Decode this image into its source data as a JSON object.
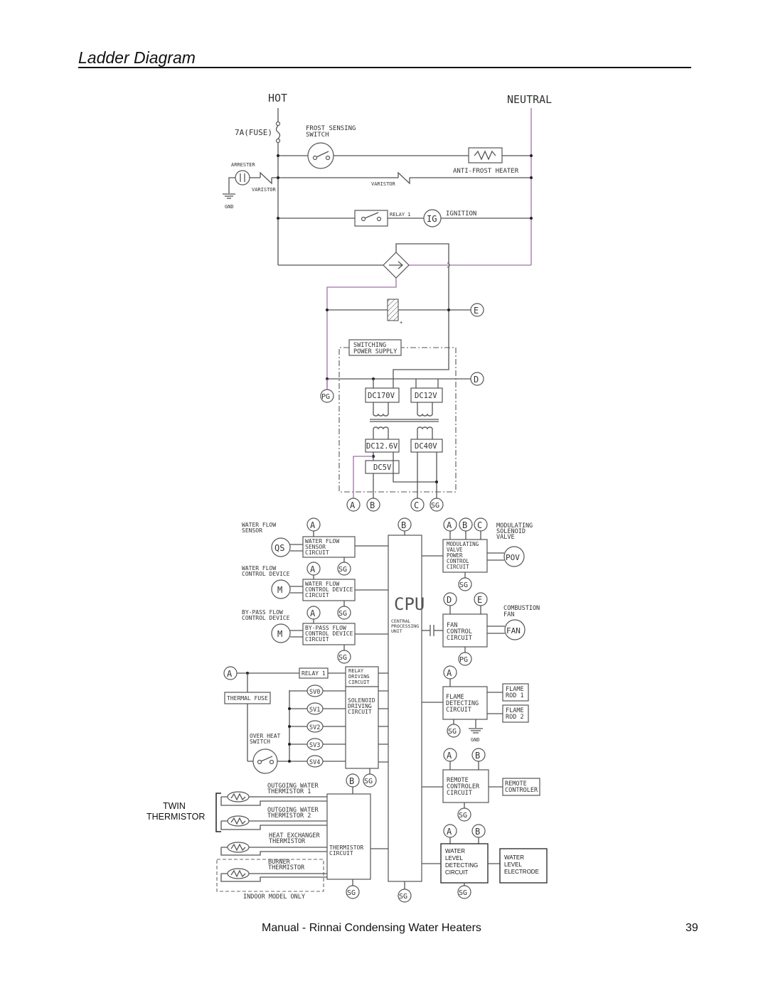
{
  "page": {
    "title": "Ladder Diagram",
    "footer": "Manual - Rinnai Condensing Water Heaters",
    "page_number": "39"
  },
  "power_section": {
    "hot_label": "HOT",
    "neutral_label": "NEUTRAL",
    "fuse_label": "7A(FUSE)",
    "frost_switch_label": [
      "FROST SENSING",
      "SWITCH"
    ],
    "anti_frost_heater_label": "ANTI-FROST HEATER",
    "arrester_label": "ARRESTER",
    "varistor_left_label": "VARISTOR",
    "varistor_mid_label": "VARISTOR",
    "gnd_label": "GND",
    "relay_label": "RELAY 1",
    "ignition_symbol": "IG",
    "ignition_label": "IGNITION",
    "rectifier_symbol": "→",
    "capacitor_plus": "+",
    "node_e": "E",
    "switching_supply_label": [
      "SWITCHING",
      "POWER SUPPLY"
    ],
    "node_d": "D",
    "node_pg": "PG",
    "dc170v": "DC170V",
    "dc12v": "DC12V",
    "dc126v": "DC12.6V",
    "dc40v": "DC40V",
    "dc5v": "DC5V",
    "outputs": [
      "A",
      "B",
      "C",
      "SG"
    ]
  },
  "control_section": {
    "cpu": {
      "label": "CPU",
      "sublabel": [
        "CENTRAL",
        "PROCESSING",
        "UNIT"
      ],
      "top_node": "B",
      "bottom_node": "SG"
    },
    "left_blocks": [
      {
        "device_label": [
          "WATER FLOW",
          "SENSOR"
        ],
        "device_symbol": "QS",
        "circuit": [
          "WATER FLOW",
          "SENSOR",
          "CIRCUIT"
        ],
        "top_nodes": [
          "A"
        ],
        "bottom_node": "SG"
      },
      {
        "device_label": [
          "WATER FLOW",
          "CONTROL DEVICE"
        ],
        "device_symbol": "M",
        "circuit": [
          "WATER FLOW",
          "CONTROL DEVICE",
          "CIRCUIT"
        ],
        "top_nodes": [
          "A",
          "SG"
        ],
        "bottom_node": ""
      },
      {
        "device_label": [
          "BY-PASS FLOW",
          "CONTROL DEVICE"
        ],
        "device_symbol": "M",
        "circuit": [
          "BY-PASS FLOW",
          "CONTROL DEVICE",
          "CIRCUIT"
        ],
        "top_nodes": [
          "A",
          "SG"
        ],
        "bottom_node": "SG"
      }
    ],
    "relay_block": {
      "node_a": "A",
      "relay_label": "RELAY 1",
      "thermal_fuse": "THERMAL FUSE",
      "over_heat_switch": [
        "OVER HEAT",
        "SWITCH"
      ],
      "relay_driving": [
        "RELAY",
        "DRIVING",
        "CIRCUIT"
      ],
      "solenoid_driving": [
        "SOLENOID",
        "DRIVING",
        "CIRCUIT"
      ],
      "solenoids": [
        "SV0",
        "SV1",
        "SV2",
        "SV3",
        "SV4"
      ]
    },
    "thermistor_block": {
      "twin_label": [
        "TWIN",
        "THERMISTOR"
      ],
      "thermistors": [
        [
          "OUTGOING WATER",
          "THERMISTOR 1"
        ],
        [
          "OUTGOING WATER",
          "THERMISTOR 2"
        ],
        [
          "HEAT EXCHANGER",
          "THERMISTOR"
        ],
        [
          "BURNER",
          "THERMISTOR"
        ]
      ],
      "indoor_only": "INDOOR MODEL ONLY",
      "circuit": [
        "THERMISTOR",
        "CIRCUIT"
      ],
      "top_nodes": [
        "B",
        "SG"
      ],
      "bottom_node": "SG"
    },
    "right_blocks": {
      "modulating": {
        "nodes": [
          "A",
          "B",
          "C"
        ],
        "circuit": [
          "MODULATING",
          "VALVE",
          "POWER",
          "CONTROL",
          "CIRCUIT"
        ],
        "device_label": [
          "MODULATING",
          "SOLENOID",
          "VALVE"
        ],
        "device_symbol": "POV",
        "bottom_node": "SG"
      },
      "fan": {
        "nodes": [
          "D",
          "E"
        ],
        "circuit": [
          "FAN",
          "CONTROL",
          "CIRCUIT"
        ],
        "device_label": [
          "COMBUSTION",
          "FAN"
        ],
        "device_symbol": "FAN",
        "bottom_node": "PG"
      },
      "flame": {
        "nodes": [
          "A"
        ],
        "circuit": [
          "FLAME",
          "DETECTING",
          "CIRCUIT"
        ],
        "rods": [
          [
            "FLAME",
            "ROD 1"
          ],
          [
            "FLAME",
            "ROD 2"
          ]
        ],
        "bottom_node": "SG",
        "gnd_label": "GND"
      },
      "remote": {
        "nodes": [
          "A",
          "B"
        ],
        "circuit": [
          "REMOTE",
          "CONTROLER",
          "CIRCUIT"
        ],
        "device": [
          "REMOTE",
          "CONTROLER"
        ],
        "bottom_node": "SG"
      },
      "water_level": {
        "nodes": [
          "A",
          "B"
        ],
        "circuit": [
          "WATER",
          "LEVEL",
          "DETECTING",
          "CIRCUIT"
        ],
        "device": [
          "WATER",
          "LEVEL",
          "ELECTRODE"
        ],
        "bottom_node": "SG"
      }
    }
  }
}
